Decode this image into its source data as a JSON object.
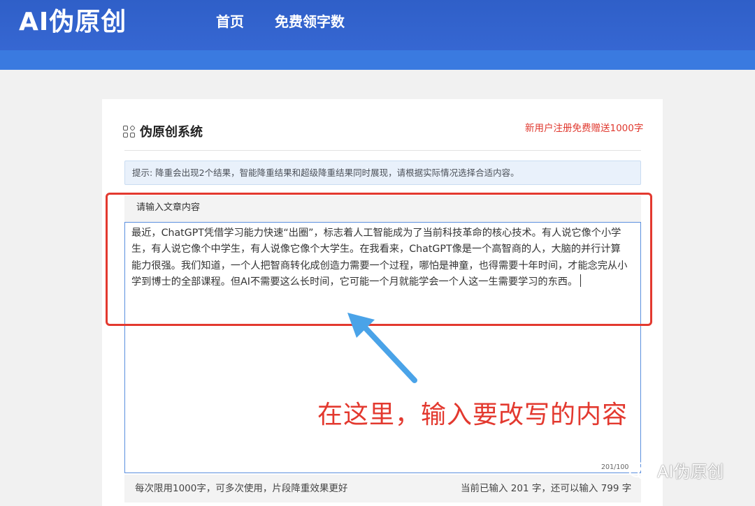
{
  "header": {
    "logo": "AI伪原创",
    "nav": [
      {
        "label": "首页"
      },
      {
        "label": "免费领字数"
      }
    ]
  },
  "card": {
    "title": "伪原创系统",
    "promo": "新用户注册免费赠送1000字",
    "hint": "提示: 降重会出现2个结果，智能降重结果和超级降重结果同时展现，请根据实际情况选择合适内容。",
    "input_label": "请输入文章内容",
    "input_value": "最近，ChatGPT凭借学习能力快速“出圈”，标志着人工智能成为了当前科技革命的核心技术。有人说它像个小学生，有人说它像个中学生，有人说像它像个大学生。在我看来，ChatGPT像是一个高智商的人，大脑的并行计算能力很强。我们知道，一个人把智商转化成创造力需要一个过程，哪怕是神童，也得需要十年时间，才能念完从小学到博士的全部课程。但AI不需要这么长时间，它可能一个月就能学会一个人这一生需要学习的东西。",
    "small_counter": "201/100",
    "footer_limit": "每次限用1000字，可多次使用，片段降重效果更好",
    "footer_count": "当前已输入 201 字，还可以输入 799 字"
  },
  "annotation": {
    "callout": "在这里，输入要改写的内容",
    "accent_color": "#e3392f",
    "arrow_color": "#4aa3e8"
  },
  "watermark": {
    "icon": "wechat-icon",
    "text": "AI伪原创"
  }
}
